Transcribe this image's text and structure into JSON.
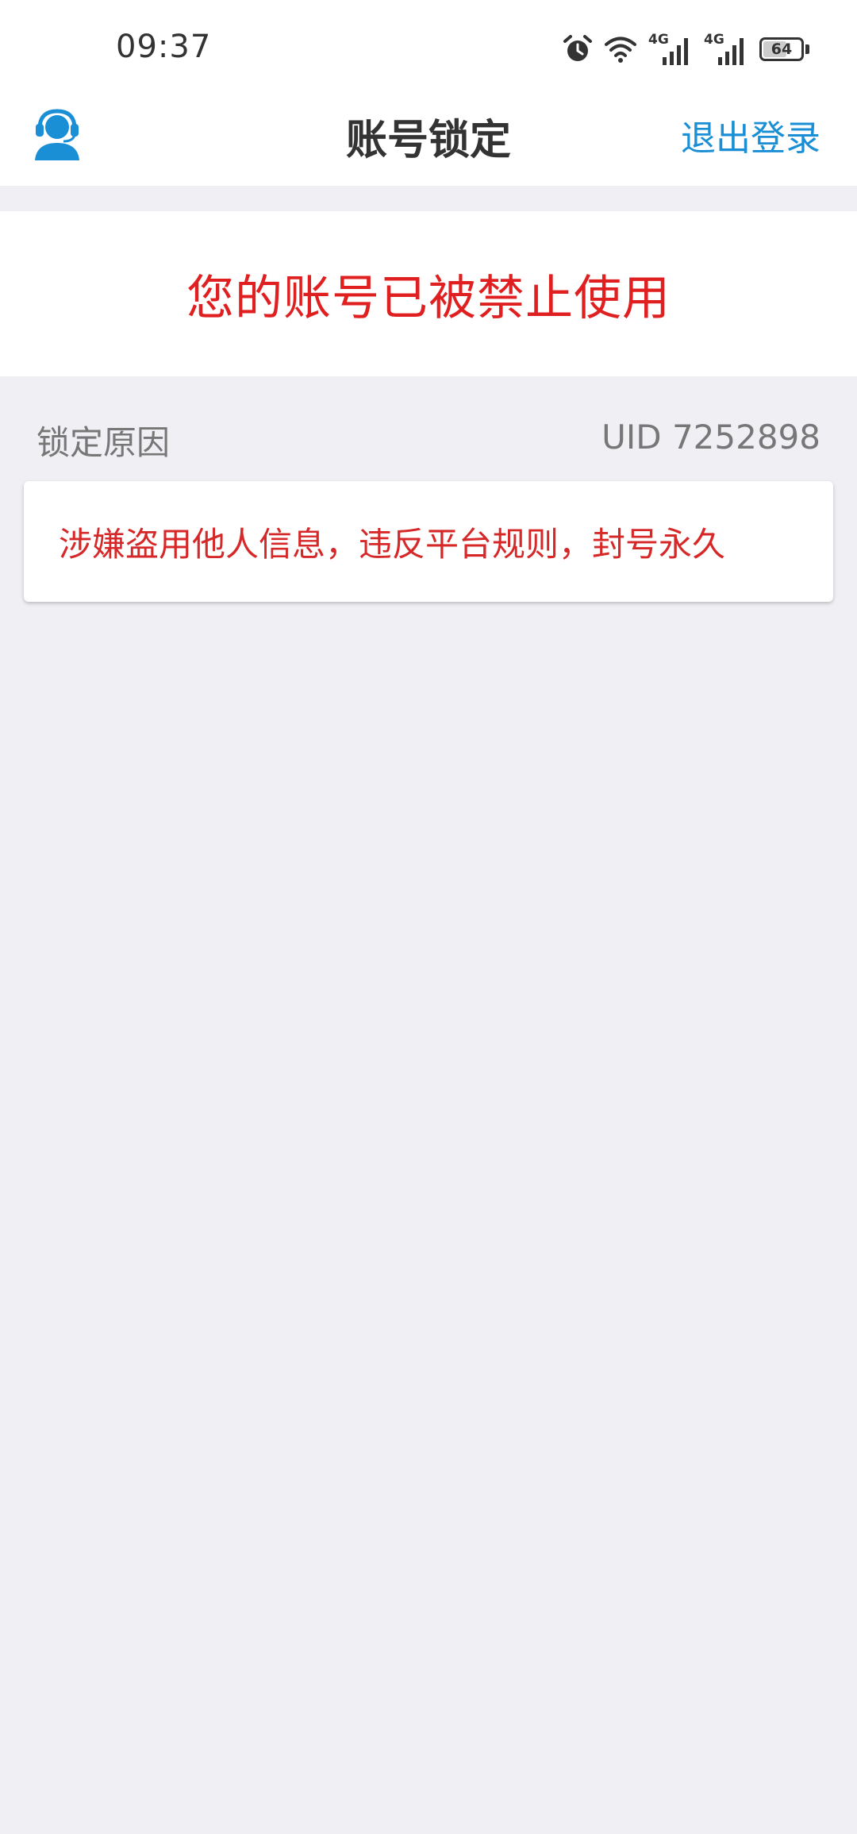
{
  "status_bar": {
    "time": "09:37",
    "network_1": "4G",
    "network_2": "4G",
    "battery": "64",
    "battery_level": 0.64,
    "icons": [
      "alarm-icon",
      "wifi-icon",
      "signal-icon",
      "signal-icon",
      "battery-icon"
    ]
  },
  "nav": {
    "title": "账号锁定",
    "logout_label": "退出登录",
    "left_icon": "customer-service-icon"
  },
  "banner": {
    "message": "您的账号已被禁止使用"
  },
  "reason_section": {
    "label": "锁定原因",
    "uid": "UID 7252898",
    "reason": "涉嫌盗用他人信息，违反平台规则，封号永久"
  },
  "colors": {
    "background": "#efeff4",
    "accent": "#1a8fd6",
    "alert": "#e02020"
  }
}
